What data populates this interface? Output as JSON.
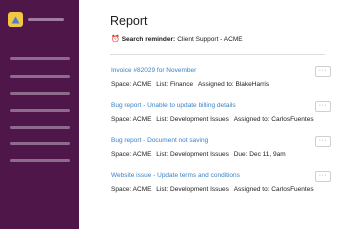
{
  "app": {
    "accent_color": "#4f164a",
    "logo_color": "#f2c744",
    "link_color": "#3b82c4"
  },
  "sidebar": {
    "logo_icon": "triangle-logo-icon",
    "nav_item_count_note": "placeholder-bars"
  },
  "main": {
    "title": "Report",
    "reminder": {
      "icon": "alarm-clock-icon",
      "clock_glyph": "⏰",
      "label": "Search reminder:",
      "value": "Client Support - ACME"
    },
    "more_glyph": "···",
    "results": [
      {
        "link": "Invoice #82029 for November",
        "space": "Space: ACME",
        "list": "List: Finance",
        "extra": "Assigned to: BlakeHarris"
      },
      {
        "link": "Bug report - Unable to update billing details",
        "space": "Space: ACME",
        "list": "List: Development Issues",
        "extra": "Assigned to: CarlosFuentes"
      },
      {
        "link": "Bug report - Document not saving",
        "space": "Space: ACME",
        "list": "List: Development Issues",
        "extra": "Due: Dec 11, 9am"
      },
      {
        "link": "Website issue - Update terms and conditions",
        "space": "Space: ACME",
        "list": "List: Development Issues",
        "extra": "Assigned to: CarlosFuentes"
      }
    ]
  }
}
